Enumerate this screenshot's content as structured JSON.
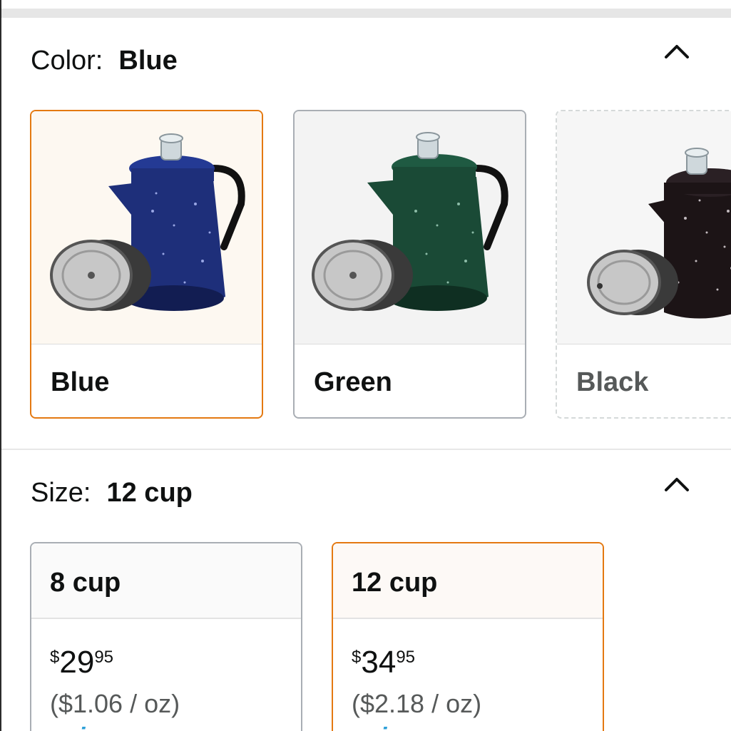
{
  "color_section": {
    "label": "Color:",
    "selected": "Blue",
    "options": [
      {
        "name": "Blue",
        "color": "#1e2f7a",
        "state": "selected"
      },
      {
        "name": "Green",
        "color": "#1a4a36",
        "state": "available"
      },
      {
        "name": "Black",
        "color": "#1c1416",
        "state": "unavailable"
      }
    ]
  },
  "size_section": {
    "label": "Size:",
    "selected": "12 cup",
    "options": [
      {
        "name": "8 cup",
        "currency": "$",
        "price_whole": "29",
        "price_fraction": "95",
        "unit_price": "($1.06 / oz)",
        "badge": "prime",
        "state": "available"
      },
      {
        "name": "12 cup",
        "currency": "$",
        "price_whole": "34",
        "price_fraction": "95",
        "unit_price": "($2.18 / oz)",
        "badge": "prime",
        "state": "selected"
      }
    ]
  },
  "colors": {
    "accent_selected": "#e47911",
    "border_default": "#a9aeb4",
    "prime_blue": "#2ea0d8"
  },
  "icons": {
    "collapse": "chevron-up-icon"
  }
}
